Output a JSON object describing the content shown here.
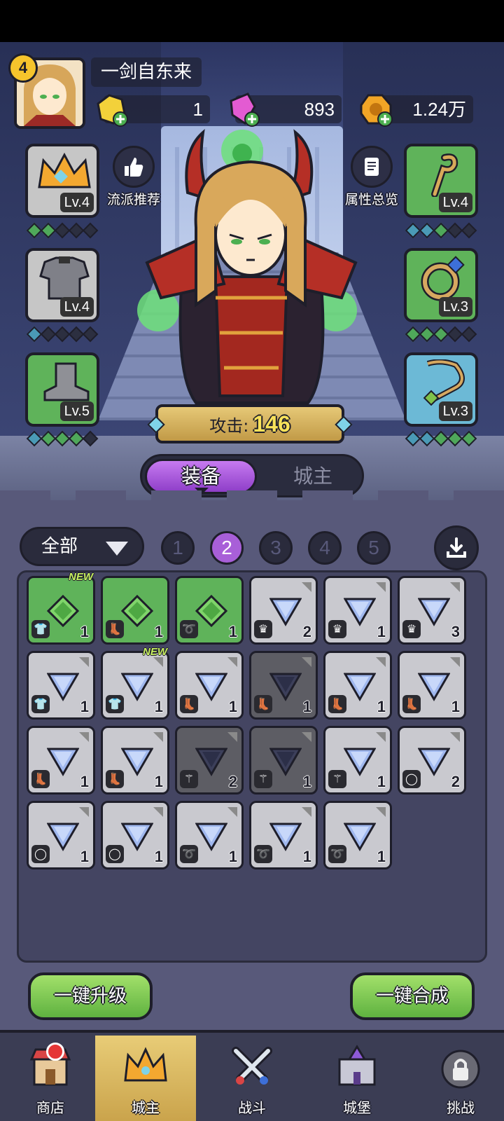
{
  "player": {
    "name": "一剑自东来",
    "level": "4"
  },
  "currencies": [
    {
      "icon": "yellow-gem-icon",
      "value": "1"
    },
    {
      "icon": "pink-crystal-icon",
      "value": "893"
    },
    {
      "icon": "gold-coin-icon",
      "value": "1.24万"
    }
  ],
  "left_slots": [
    {
      "icon": "crown-icon",
      "level": "Lv.4",
      "rarity": "gray"
    },
    {
      "icon": "armor-icon",
      "level": "Lv.4",
      "rarity": "gray"
    },
    {
      "icon": "boot-icon",
      "level": "Lv.5",
      "rarity": "green"
    }
  ],
  "right_slots": [
    {
      "icon": "staff-icon",
      "level": "Lv.4",
      "rarity": "green"
    },
    {
      "icon": "ring-icon",
      "level": "Lv.3",
      "rarity": "green"
    },
    {
      "icon": "necklace-icon",
      "level": "Lv.3",
      "rarity": "blue"
    }
  ],
  "side_buttons": {
    "recommend": "流派推荐",
    "attributes": "属性总览"
  },
  "attack": {
    "label": "攻击:",
    "value": "146"
  },
  "tabs": {
    "equipment": "装备",
    "lord": "城主"
  },
  "filter": {
    "selected": "全部"
  },
  "pages": [
    "1",
    "2",
    "3",
    "4",
    "5"
  ],
  "active_page": "2",
  "items": [
    {
      "rarity": "green",
      "slot": "shirt",
      "count": "1",
      "new": "NEW"
    },
    {
      "rarity": "green",
      "slot": "boot",
      "count": "1"
    },
    {
      "rarity": "green",
      "slot": "neck",
      "count": "1"
    },
    {
      "rarity": "gray",
      "slot": "crown",
      "count": "2"
    },
    {
      "rarity": "gray",
      "slot": "crown",
      "count": "1"
    },
    {
      "rarity": "gray",
      "slot": "crown",
      "count": "3"
    },
    {
      "rarity": "gray",
      "slot": "shirt",
      "count": "1"
    },
    {
      "rarity": "gray",
      "slot": "shirt",
      "count": "1",
      "new": "NEW"
    },
    {
      "rarity": "gray",
      "slot": "boot",
      "count": "1"
    },
    {
      "rarity": "dark",
      "slot": "boot",
      "count": "1"
    },
    {
      "rarity": "gray",
      "slot": "boot",
      "count": "1"
    },
    {
      "rarity": "gray",
      "slot": "boot",
      "count": "1"
    },
    {
      "rarity": "gray",
      "slot": "boot",
      "count": "1"
    },
    {
      "rarity": "gray",
      "slot": "boot",
      "count": "1"
    },
    {
      "rarity": "dark",
      "slot": "staff",
      "count": "2"
    },
    {
      "rarity": "dark",
      "slot": "staff",
      "count": "1"
    },
    {
      "rarity": "gray",
      "slot": "staff",
      "count": "1"
    },
    {
      "rarity": "gray",
      "slot": "ring",
      "count": "2"
    },
    {
      "rarity": "gray",
      "slot": "ring",
      "count": "1"
    },
    {
      "rarity": "gray",
      "slot": "ring",
      "count": "1"
    },
    {
      "rarity": "gray",
      "slot": "neck",
      "count": "1"
    },
    {
      "rarity": "gray",
      "slot": "neck",
      "count": "1"
    },
    {
      "rarity": "gray",
      "slot": "neck",
      "count": "1"
    }
  ],
  "buttons": {
    "upgrade_all": "一键升级",
    "merge_all": "一键合成"
  },
  "nav": [
    {
      "label": "商店",
      "icon": "shop-icon"
    },
    {
      "label": "城主",
      "icon": "crown-icon"
    },
    {
      "label": "战斗",
      "icon": "swords-icon"
    },
    {
      "label": "城堡",
      "icon": "castle-icon"
    },
    {
      "label": "挑战",
      "icon": "locked-challenge-icon"
    }
  ],
  "colors": {
    "accent_purple": "#a85fd8",
    "green_btn": "#5fb240",
    "rarity_green": "#5fb35a",
    "rarity_blue": "#6cb9d6"
  }
}
